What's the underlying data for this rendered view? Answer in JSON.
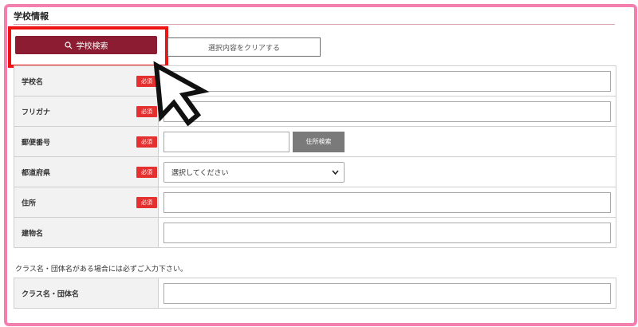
{
  "section": {
    "title": "学校情報"
  },
  "toolbar": {
    "search_label": "学校検索",
    "clear_label": "選択内容をクリアする"
  },
  "required_badge": "必須",
  "fields": [
    {
      "label": "学校名",
      "required": true
    },
    {
      "label": "フリガナ",
      "required": true
    },
    {
      "label": "郵便番号",
      "required": true,
      "address_button": "住所検索"
    },
    {
      "label": "都道府県",
      "required": true,
      "select_value": "選択してください"
    },
    {
      "label": "住所",
      "required": true
    },
    {
      "label": "建物名",
      "required": false
    }
  ],
  "note": "クラス名・団体名がある場合には必ずご入力下さい。",
  "class_field": {
    "label": "クラス名・団体名"
  },
  "colors": {
    "frame": "#f47fae",
    "primary_button": "#8b1c31",
    "required_badge": "#e53030",
    "highlight": "#ee1414"
  },
  "icons": {
    "search": "search-icon",
    "select": "chevron-down-icon",
    "pointer": "cursor-arrow-icon"
  }
}
